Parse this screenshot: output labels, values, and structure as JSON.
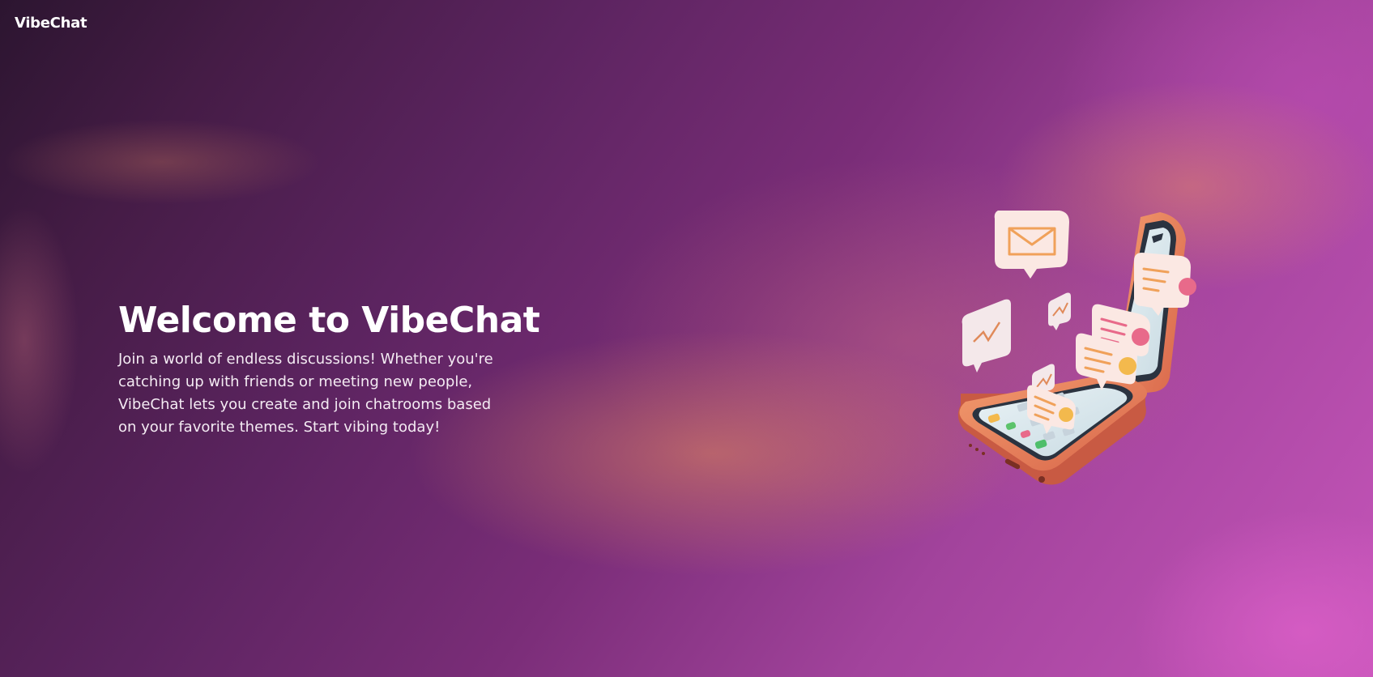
{
  "app": {
    "brand": "VibeChat"
  },
  "hero": {
    "title": "Welcome to VibeChat",
    "description": "Join a world of endless discussions! Whether you're catching up with friends or meeting new people, VibeChat lets you create and join chatrooms based on your favorite themes. Start vibing today!"
  },
  "illustration": {
    "icon": "phone-chat-illustration",
    "elements": [
      "envelope-icon",
      "chat-bubble-icon",
      "phone-icon"
    ]
  },
  "colors": {
    "phone_body": "#e8835a",
    "bubble": "#fbe8e3",
    "accent_pink": "#e86a8a",
    "accent_yellow": "#f3b94d",
    "screen": "#dfeaf0"
  }
}
